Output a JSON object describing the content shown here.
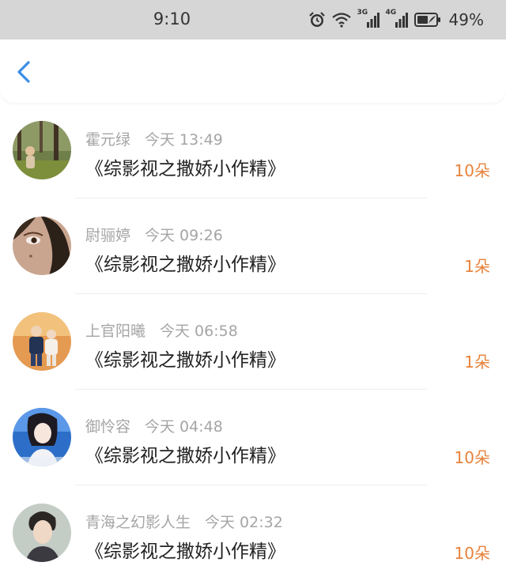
{
  "status_bar": {
    "time": "9:10",
    "network_3g": "3G",
    "network_4g": "4G",
    "battery_percent": "49%",
    "icons": [
      "alarm-icon",
      "wifi-icon",
      "signal-3g-icon",
      "signal-4g-icon",
      "battery-icon"
    ]
  },
  "header": {
    "back_icon": "chevron-left-icon",
    "accent_color": "#3a8ee6"
  },
  "colors": {
    "count": "#e8823b",
    "meta": "#a5a5a5",
    "title": "#222222"
  },
  "items": [
    {
      "name": "霍元绿",
      "time": "今天 13:49",
      "title": "《综影视之撒娇小作精》",
      "count": "10朵"
    },
    {
      "name": "尉骊婷",
      "time": "今天 09:26",
      "title": "《综影视之撒娇小作精》",
      "count": "1朵"
    },
    {
      "name": "上官阳曦",
      "time": "今天 06:58",
      "title": "《综影视之撒娇小作精》",
      "count": "1朵"
    },
    {
      "name": "御怜容",
      "time": "今天 04:48",
      "title": "《综影视之撒娇小作精》",
      "count": "10朵"
    },
    {
      "name": "青海之幻影人生",
      "time": "今天 02:32",
      "title": "《综影视之撒娇小作精》",
      "count": "10朵"
    }
  ]
}
